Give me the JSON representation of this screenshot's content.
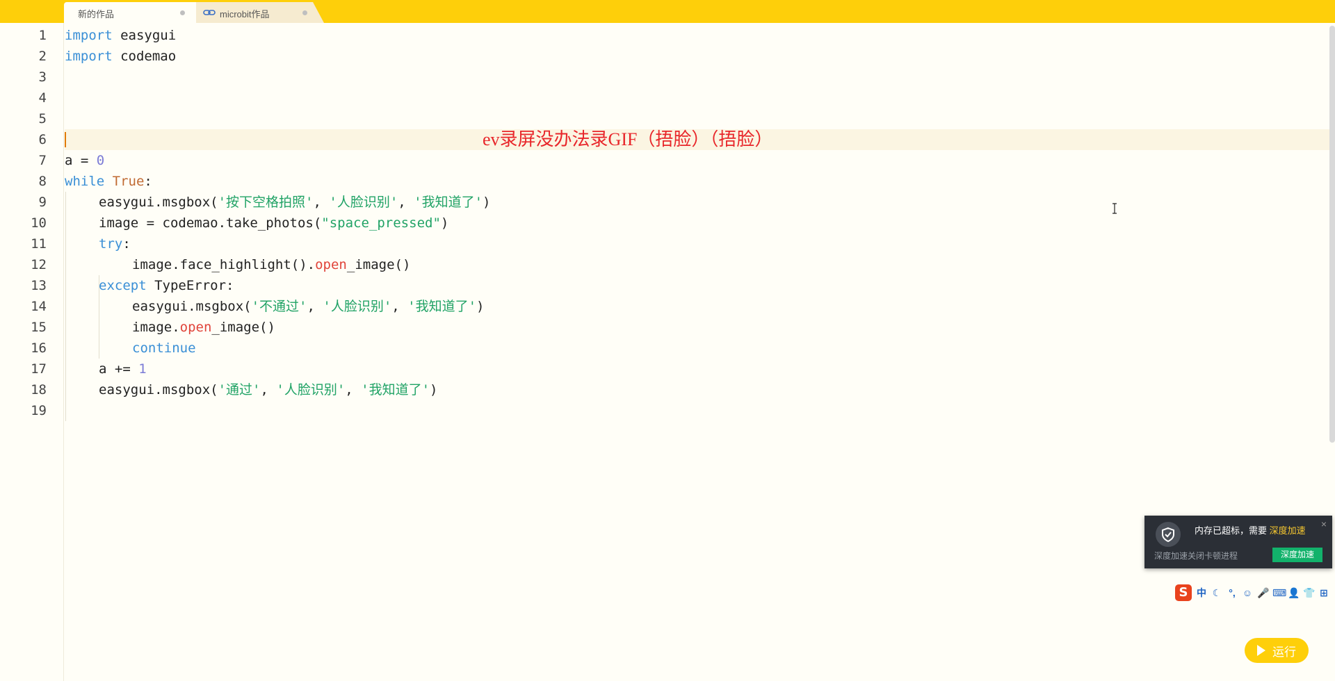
{
  "tabs": [
    {
      "label": "新的作品",
      "icon": "none",
      "active": true
    },
    {
      "label": "microbit作品",
      "icon": "link-icon",
      "active": false
    }
  ],
  "editor": {
    "line_numbers": [
      "1",
      "2",
      "3",
      "4",
      "5",
      "6",
      "7",
      "8",
      "9",
      "10",
      "11",
      "12",
      "13",
      "14",
      "15",
      "16",
      "17",
      "18",
      "19"
    ],
    "code": {
      "l1": {
        "kw": "import",
        "rest": " easygui"
      },
      "l2": {
        "kw": "import",
        "rest": " codemao"
      },
      "l7": {
        "a": "a = ",
        "num": "0"
      },
      "l8": {
        "kw": "while",
        "sp": " ",
        "kw2": "True",
        "rest": ":"
      },
      "l9": {
        "pre": "easygui.msgbox(",
        "s1": "'按下空格拍照'",
        "c1": ", ",
        "s2": "'人脸识别'",
        "c2": ", ",
        "s3": "'我知道了'",
        "end": ")"
      },
      "l10": {
        "pre": "image = codemao.take_photos(",
        "s1": "\"space_pressed\"",
        "end": ")"
      },
      "l11": {
        "kw": "try",
        "rest": ":"
      },
      "l12": {
        "pre": "image.face_highlight().",
        "red": "open",
        "rest": "_image()"
      },
      "l13": {
        "kw": "except",
        "rest": " TypeError:"
      },
      "l14": {
        "pre": "easygui.msgbox(",
        "s1": "'不通过'",
        "c1": ", ",
        "s2": "'人脸识别'",
        "c2": ", ",
        "s3": "'我知道了'",
        "end": ")"
      },
      "l15": {
        "pre": "image.",
        "red": "open",
        "rest": "_image()"
      },
      "l16": {
        "kw": "continue"
      },
      "l17": {
        "pre": "a += ",
        "num": "1"
      },
      "l18": {
        "pre": "easygui.msgbox(",
        "s1": "'通过'",
        "c1": ", ",
        "s2": "'人脸识别'",
        "c2": ", ",
        "s3": "'我知道了'",
        "end": ")"
      }
    },
    "watermark": "ev录屏没办法录GIF（捂脸）（捂脸）"
  },
  "memory_popup": {
    "title": "内存已超标，需要 ",
    "title_highlight": "深度加速",
    "subtitle": "深度加速关闭卡顿进程",
    "button_label": "深度加速",
    "close_icon": "×"
  },
  "ime_toolbar": {
    "logo": "S",
    "items": [
      "中",
      "☾",
      "°,",
      "☺",
      "🎤",
      "⌨",
      "👤",
      "👕",
      "⊞"
    ]
  },
  "run_button": {
    "label": "运行"
  },
  "colors": {
    "accent": "#fecf0a",
    "keyword": "#3a8fd6",
    "string": "#21a366",
    "number": "#7b7bd6",
    "watermark": "#e8262a",
    "success": "#12b26b"
  }
}
